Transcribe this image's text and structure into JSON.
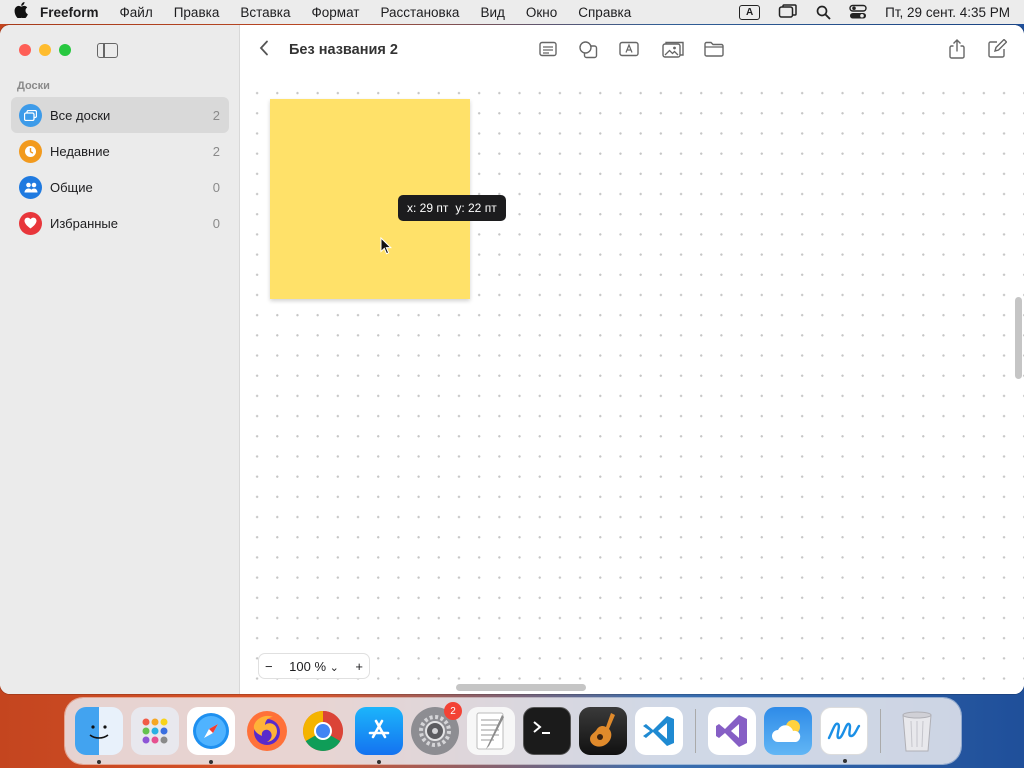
{
  "menubar": {
    "app_name": "Freeform",
    "items": [
      "Файл",
      "Правка",
      "Вставка",
      "Формат",
      "Расстановка",
      "Вид",
      "Окно",
      "Справка"
    ],
    "input_indicator": "A",
    "datetime": "Пт, 29 сент.  4:35 PM"
  },
  "sidebar": {
    "section_title": "Доски",
    "items": [
      {
        "label": "Все доски",
        "count": "2",
        "color": "#3d9be9"
      },
      {
        "label": "Недавние",
        "count": "2",
        "color": "#f29a1e"
      },
      {
        "label": "Общие",
        "count": "0",
        "color": "#1f7ae0"
      },
      {
        "label": "Избранные",
        "count": "0",
        "color": "#e8363b"
      }
    ]
  },
  "toolbar": {
    "back": "‹",
    "title": "Без названия 2"
  },
  "canvas": {
    "sticky_color": "#ffe169",
    "tooltip_x": "x: 29 пт",
    "tooltip_y": "y: 22 пт"
  },
  "zoom": {
    "minus": "−",
    "value": "100 %",
    "chevron": "⌄",
    "plus": "+"
  },
  "dock": {
    "badge_settings": "2",
    "apps": [
      "finder-icon",
      "launchpad-icon",
      "safari-icon",
      "firefox-icon",
      "chrome-icon",
      "app-store-icon",
      "system-settings-icon",
      "textedit-icon",
      "terminal-icon",
      "garageband-icon",
      "vscode-icon",
      "visual-studio-icon",
      "weather-icon",
      "freeform-icon",
      "trash-icon"
    ]
  }
}
